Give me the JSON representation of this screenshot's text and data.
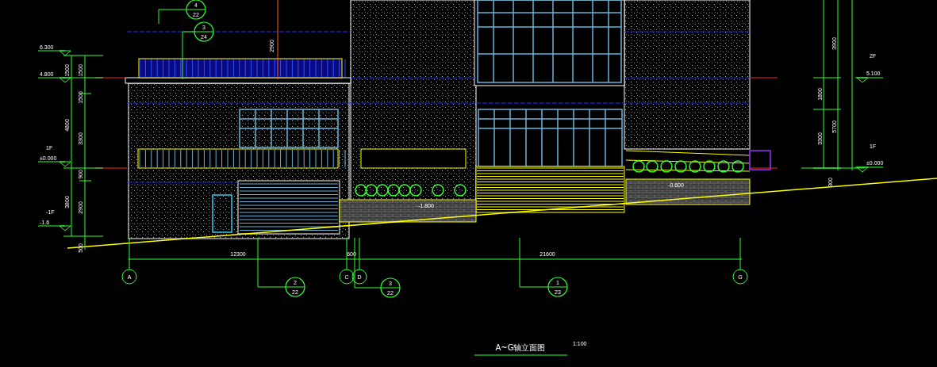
{
  "drawing_title": "A~G轴立面图",
  "scale": "1:100",
  "axes": [
    {
      "label": "A"
    },
    {
      "label": "C"
    },
    {
      "label": "D"
    },
    {
      "label": "G"
    }
  ],
  "axis_dimensions": [
    "12300",
    "600",
    "21600"
  ],
  "callouts": [
    {
      "number": "4",
      "sheet": "22"
    },
    {
      "number": "3",
      "sheet": "24"
    },
    {
      "number": "2",
      "sheet": "22"
    },
    {
      "number": "3",
      "sheet": "22"
    },
    {
      "number": "1",
      "sheet": "23"
    }
  ],
  "left_levels": [
    {
      "elevation": "6.300"
    },
    {
      "elevation": "4.800"
    },
    {
      "floor": "1F",
      "elevation": "±0.000"
    },
    {
      "floor": "-1F",
      "elevation": "-1.6"
    }
  ],
  "left_outer_dimensions": [
    "1500",
    "4800",
    "3800"
  ],
  "left_inner_dimensions": [
    "1500",
    "1500",
    "3300",
    "900",
    "2900",
    "500"
  ],
  "right_levels": [
    {
      "floor": "2F",
      "elevation": "5.100"
    },
    {
      "floor": "1F",
      "elevation": "±0.000"
    }
  ],
  "right_outer_dimensions": [
    "3900",
    "5700",
    "300"
  ],
  "right_inner_dimensions": [
    "1800",
    "3300"
  ],
  "parapet_dimension": "2900",
  "ground_levels": [
    "-1.800",
    "-0.600"
  ]
}
